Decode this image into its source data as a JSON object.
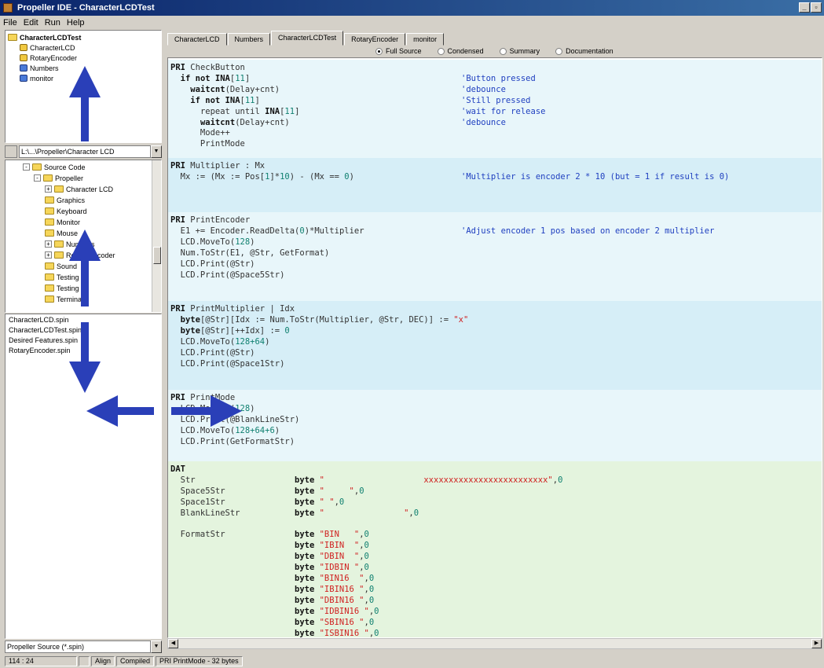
{
  "window": {
    "title": "Propeller IDE - CharacterLCDTest",
    "buttons": [
      "_",
      "▫"
    ]
  },
  "menu": [
    "File",
    "Edit",
    "Run",
    "Help"
  ],
  "object_tree": {
    "root": "CharacterLCDTest",
    "children": [
      {
        "label": "CharacterLCD",
        "icon": "file-icon-yellow"
      },
      {
        "label": "RotaryEncoder",
        "icon": "file-icon-yellow"
      },
      {
        "label": "Numbers",
        "icon": "file-icon-blue"
      },
      {
        "label": "monitor",
        "icon": "file-icon-blue"
      }
    ]
  },
  "folder_path": "L:\\...\\Propeller\\Character LCD",
  "folder_tree": [
    {
      "label": "Source Code",
      "level": 1,
      "expander": "-"
    },
    {
      "label": "Propeller",
      "level": 2,
      "expander": "-"
    },
    {
      "label": "Character LCD",
      "level": 3,
      "expander": "+"
    },
    {
      "label": "Graphics",
      "level": 3,
      "expander": ""
    },
    {
      "label": "Keyboard",
      "level": 3,
      "expander": ""
    },
    {
      "label": "Monitor",
      "level": 3,
      "expander": ""
    },
    {
      "label": "Mouse",
      "level": 3,
      "expander": ""
    },
    {
      "label": "Numbers",
      "level": 3,
      "expander": "+"
    },
    {
      "label": "Rotary Encoder",
      "level": 3,
      "expander": "+"
    },
    {
      "label": "Sound",
      "level": 3,
      "expander": ""
    },
    {
      "label": "Testing",
      "level": 3,
      "expander": ""
    },
    {
      "label": "Testing 2",
      "level": 3,
      "expander": ""
    },
    {
      "label": "Terminal",
      "level": 3,
      "expander": ""
    }
  ],
  "file_list": [
    "CharacterLCD.spin",
    "CharacterLCDTest.spin",
    "Desired Features.spin",
    "RotaryEncoder.spin"
  ],
  "file_filter": "Propeller Source (*.spin)",
  "tabs": [
    "CharacterLCD",
    "Numbers",
    "CharacterLCDTest",
    "RotaryEncoder",
    "monitor"
  ],
  "active_tab": "CharacterLCDTest",
  "view_modes": [
    "Full Source",
    "Condensed",
    "Summary",
    "Documentation"
  ],
  "selected_view_mode": "Full Source",
  "code_blocks": [
    {
      "kind": "pri1",
      "lines": [
        [
          [
            "kw",
            "PRI"
          ],
          [
            "",
            "CheckButton"
          ]
        ],
        [
          [
            "",
            "  "
          ],
          [
            "kw",
            "if not INA"
          ],
          [
            "",
            "["
          ],
          [
            "num",
            "11"
          ],
          [
            "",
            "]"
          ],
          [
            "pad",
            ""
          ],
          [
            "com",
            "'Button pressed"
          ]
        ],
        [
          [
            "",
            "    "
          ],
          [
            "kw",
            "waitcnt"
          ],
          [
            "",
            "(Delay+cnt)"
          ],
          [
            "pad",
            ""
          ],
          [
            "com",
            "'debounce"
          ]
        ],
        [
          [
            "",
            "    "
          ],
          [
            "kw",
            "if not INA"
          ],
          [
            "",
            "["
          ],
          [
            "num",
            "11"
          ],
          [
            "",
            "]"
          ],
          [
            "pad",
            ""
          ],
          [
            "com",
            "'Still pressed"
          ]
        ],
        [
          [
            "",
            "      "
          ],
          [
            "",
            "repeat until "
          ],
          [
            "kw",
            "INA"
          ],
          [
            "",
            "["
          ],
          [
            "num",
            "11"
          ],
          [
            "",
            "]"
          ],
          [
            "pad",
            ""
          ],
          [
            "com",
            "'wait for release"
          ]
        ],
        [
          [
            "",
            "      "
          ],
          [
            "kw",
            "waitcnt"
          ],
          [
            "",
            "(Delay+cnt)"
          ],
          [
            "pad",
            ""
          ],
          [
            "com",
            "'debounce"
          ]
        ],
        [
          [
            "",
            "      Mode++"
          ]
        ],
        [
          [
            "",
            "      PrintMode"
          ]
        ]
      ]
    },
    {
      "kind": "pri2",
      "lines": [
        [
          [
            "kw",
            "PRI"
          ],
          [
            "",
            "Multiplier : Mx"
          ]
        ],
        [
          [
            "",
            "  Mx := (Mx := Pos["
          ],
          [
            "num",
            "1"
          ],
          [
            "",
            "]*"
          ],
          [
            "num",
            "10"
          ],
          [
            "",
            ") - (Mx == "
          ],
          [
            "num",
            "0"
          ],
          [
            "",
            ")"
          ],
          [
            "pad",
            ""
          ],
          [
            "com",
            "'Multiplier is encoder 2 * 10 (but = 1 if result is 0)"
          ]
        ]
      ]
    },
    {
      "kind": "pri1",
      "lines": [
        [
          [
            "kw",
            "PRI"
          ],
          [
            "",
            "PrintEncoder"
          ]
        ],
        [
          [
            "",
            "  E1 += Encoder.ReadDelta("
          ],
          [
            "num",
            "0"
          ],
          [
            "",
            ")*Multiplier"
          ],
          [
            "pad",
            ""
          ],
          [
            "com",
            "'Adjust encoder 1 pos based on encoder 2 multiplier"
          ]
        ],
        [
          [
            "",
            "  LCD.MoveTo("
          ],
          [
            "num",
            "128"
          ],
          [
            "",
            ")"
          ]
        ],
        [
          [
            "",
            "  Num.ToStr(E1, @Str, GetFormat)"
          ]
        ],
        [
          [
            "",
            "  LCD.Print(@Str)"
          ]
        ],
        [
          [
            "",
            "  LCD.Print(@Space5Str)"
          ]
        ]
      ]
    },
    {
      "kind": "pri2",
      "lines": [
        [
          [
            "kw",
            "PRI"
          ],
          [
            "",
            "PrintMultiplier | Idx"
          ]
        ],
        [
          [
            "",
            "  "
          ],
          [
            "kw",
            "byte"
          ],
          [
            "",
            "[@Str][Idx := Num.ToStr(Multiplier, @Str, DEC)] := "
          ],
          [
            "str",
            "\"x\""
          ]
        ],
        [
          [
            "",
            "  "
          ],
          [
            "kw",
            "byte"
          ],
          [
            "",
            "[@Str][++Idx] := "
          ],
          [
            "num",
            "0"
          ]
        ],
        [
          [
            "",
            "  LCD.MoveTo("
          ],
          [
            "num",
            "128+64"
          ],
          [
            "",
            ")"
          ]
        ],
        [
          [
            "",
            "  LCD.Print(@Str)"
          ]
        ],
        [
          [
            "",
            "  LCD.Print(@Space1Str)"
          ]
        ]
      ]
    },
    {
      "kind": "pri1",
      "lines": [
        [
          [
            "kw",
            "PRI"
          ],
          [
            "",
            "PrintMode"
          ]
        ],
        [
          [
            "",
            "  LCD.MoveTo("
          ],
          [
            "num",
            "128"
          ],
          [
            "",
            ")"
          ]
        ],
        [
          [
            "",
            "  LCD.Print(@BlankLineStr)"
          ]
        ],
        [
          [
            "",
            "  LCD.MoveTo("
          ],
          [
            "num",
            "128+64+6"
          ],
          [
            "",
            ")"
          ]
        ],
        [
          [
            "",
            "  LCD.Print(GetFormatStr)"
          ]
        ]
      ]
    },
    {
      "kind": "dat",
      "lines": [
        [
          [
            "kw",
            "DAT"
          ]
        ],
        [
          [
            "",
            "  Str"
          ],
          [
            "datpad",
            ""
          ],
          [
            "kw",
            "byte "
          ],
          [
            "str",
            "\"                    xxxxxxxxxxxxxxxxxxxxxxxxx\""
          ],
          [
            "",
            ","
          ],
          [
            "num",
            "0"
          ]
        ],
        [
          [
            "",
            "  Space5Str"
          ],
          [
            "datpad",
            ""
          ],
          [
            "kw",
            "byte "
          ],
          [
            "str",
            "\"     \""
          ],
          [
            "",
            ","
          ],
          [
            "num",
            "0"
          ]
        ],
        [
          [
            "",
            "  Space1Str"
          ],
          [
            "datpad",
            ""
          ],
          [
            "kw",
            "byte "
          ],
          [
            "str",
            "\" \""
          ],
          [
            "",
            ","
          ],
          [
            "num",
            "0"
          ]
        ],
        [
          [
            "",
            "  BlankLineStr"
          ],
          [
            "datpad",
            ""
          ],
          [
            "kw",
            "byte "
          ],
          [
            "str",
            "\"                \""
          ],
          [
            "",
            ","
          ],
          [
            "num",
            "0"
          ]
        ],
        [
          [
            "",
            ""
          ]
        ],
        [
          [
            "",
            "  FormatStr"
          ],
          [
            "datpad",
            ""
          ],
          [
            "kw",
            "byte "
          ],
          [
            "str",
            "\"BIN   \""
          ],
          [
            "",
            ","
          ],
          [
            "num",
            "0"
          ]
        ],
        [
          [
            "datpad0",
            ""
          ],
          [
            "kw",
            "byte "
          ],
          [
            "str",
            "\"IBIN  \""
          ],
          [
            "",
            ","
          ],
          [
            "num",
            "0"
          ]
        ],
        [
          [
            "datpad0",
            ""
          ],
          [
            "kw",
            "byte "
          ],
          [
            "str",
            "\"DBIN  \""
          ],
          [
            "",
            ","
          ],
          [
            "num",
            "0"
          ]
        ],
        [
          [
            "datpad0",
            ""
          ],
          [
            "kw",
            "byte "
          ],
          [
            "str",
            "\"IDBIN \""
          ],
          [
            "",
            ","
          ],
          [
            "num",
            "0"
          ]
        ],
        [
          [
            "datpad0",
            ""
          ],
          [
            "kw",
            "byte "
          ],
          [
            "str",
            "\"BIN16  \""
          ],
          [
            "",
            ","
          ],
          [
            "num",
            "0"
          ]
        ],
        [
          [
            "datpad0",
            ""
          ],
          [
            "kw",
            "byte "
          ],
          [
            "str",
            "\"IBIN16 \""
          ],
          [
            "",
            ","
          ],
          [
            "num",
            "0"
          ]
        ],
        [
          [
            "datpad0",
            ""
          ],
          [
            "kw",
            "byte "
          ],
          [
            "str",
            "\"DBIN16 \""
          ],
          [
            "",
            ","
          ],
          [
            "num",
            "0"
          ]
        ],
        [
          [
            "datpad0",
            ""
          ],
          [
            "kw",
            "byte "
          ],
          [
            "str",
            "\"IDBIN16 \""
          ],
          [
            "",
            ","
          ],
          [
            "num",
            "0"
          ]
        ],
        [
          [
            "datpad0",
            ""
          ],
          [
            "kw",
            "byte "
          ],
          [
            "str",
            "\"SBIN16 \""
          ],
          [
            "",
            ","
          ],
          [
            "num",
            "0"
          ]
        ],
        [
          [
            "datpad0",
            ""
          ],
          [
            "kw",
            "byte "
          ],
          [
            "str",
            "\"ISBIN16 \""
          ],
          [
            "",
            ","
          ],
          [
            "num",
            "0"
          ]
        ]
      ]
    }
  ],
  "status": [
    "114 : 24",
    "",
    "Align",
    "Compiled",
    "PRI PrintMode - 32 bytes"
  ],
  "colors": {
    "arrow": "#2a3fb8",
    "title_start": "#0a246a",
    "title_end": "#3a6ea5"
  }
}
